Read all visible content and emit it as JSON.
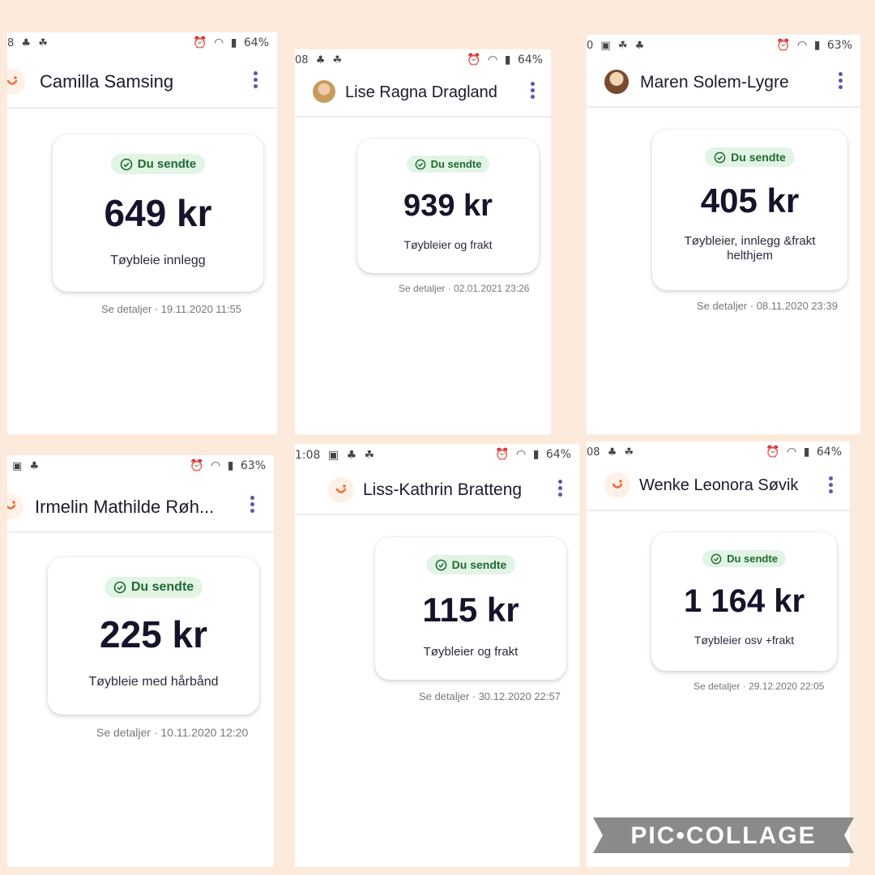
{
  "panels": [
    {
      "status_left": [
        "8",
        "♣",
        "☘"
      ],
      "battery": "64%",
      "name": "Camilla Samsing",
      "avatar": "app-logo-icon",
      "badge": "Du sendte",
      "amount": "649 kr",
      "description": "Tøybleie innlegg",
      "details": "Se detaljer · 19.11.2020 11:55"
    },
    {
      "status_left": [
        "08",
        "♣",
        "☘"
      ],
      "battery": "64%",
      "name": "Lise Ragna Dragland",
      "avatar": "profile-photo-icon",
      "badge": "Du sendte",
      "amount": "939 kr",
      "description": "Tøybleier og frakt",
      "details": "Se detaljer · 02.01.2021 23:26"
    },
    {
      "status_left": [
        "0",
        "▣",
        "☘",
        "♣"
      ],
      "battery": "63%",
      "name": "Maren Solem-Lygre",
      "avatar": "profile-photo-icon",
      "badge": "Du sendte",
      "amount": "405 kr",
      "description": "Tøybleier, innlegg &frakt helthjem",
      "details": "Se detaljer · 08.11.2020 23:39"
    },
    {
      "status_left": [
        "▣",
        "♣"
      ],
      "battery": "63%",
      "name": "Irmelin Mathilde Røh...",
      "avatar": "app-logo-icon",
      "badge": "Du sendte",
      "amount": "225 kr",
      "description": "Tøybleie med hårbånd",
      "details": "Se detaljer · 10.11.2020 12:20"
    },
    {
      "status_left": [
        "1:08",
        "▣",
        "♣",
        "☘"
      ],
      "battery": "64%",
      "name": "Liss-Kathrin Bratteng",
      "avatar": "app-logo-icon",
      "badge": "Du sendte",
      "amount": "115 kr",
      "description": "Tøybleier og frakt",
      "details": "Se detaljer · 30.12.2020 22:57"
    },
    {
      "status_left": [
        "08",
        "♣",
        "☘"
      ],
      "battery": "64%",
      "name": "Wenke Leonora Søvik",
      "avatar": "app-logo-icon",
      "badge": "Du sendte",
      "amount": "1 164 kr",
      "description": "Tøybleier osv +frakt",
      "details": "Se detaljer · 29.12.2020 22:05"
    }
  ],
  "watermark": "PIC•COLLAGE",
  "colors": {
    "background": "#fcebdc",
    "badge_bg": "#e2f4e5",
    "badge_text": "#1f6b30",
    "kebab": "#6a4fb0",
    "logo": "#f26b35",
    "watermark": "#8a8a8a"
  }
}
